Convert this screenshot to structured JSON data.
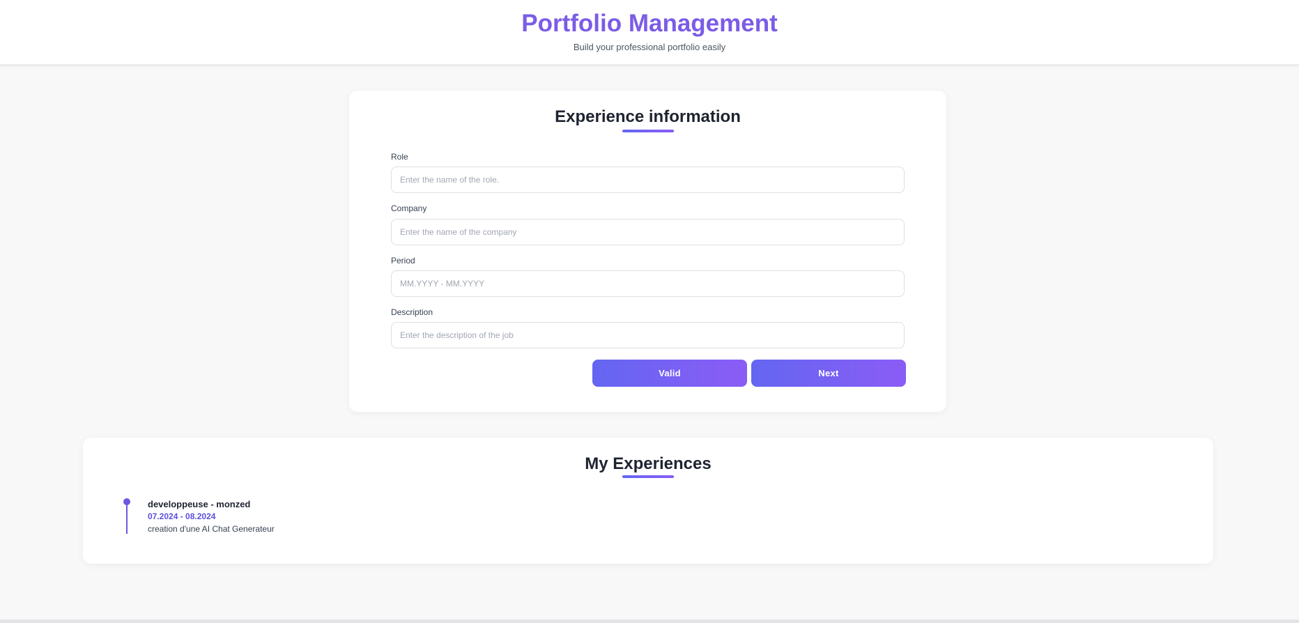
{
  "header": {
    "title": "Portfolio Management",
    "subtitle": "Build your professional portfolio easily"
  },
  "form": {
    "title": "Experience information",
    "fields": {
      "role": {
        "label": "Role",
        "placeholder": "Enter the name of the role.",
        "value": ""
      },
      "company": {
        "label": "Company",
        "placeholder": "Enter the name of the company",
        "value": ""
      },
      "period": {
        "label": "Period",
        "placeholder": "MM.YYYY - MM.YYYY",
        "value": ""
      },
      "description": {
        "label": "Description",
        "placeholder": "Enter the description of the job",
        "value": ""
      }
    },
    "buttons": {
      "valid": "Valid",
      "next": "Next"
    }
  },
  "experiences": {
    "title": "My Experiences",
    "items": [
      {
        "role": "developpeuse",
        "separator": " - ",
        "company": "monzed",
        "period": "07.2024 - 08.2024",
        "description": "creation d'une AI Chat Generateur"
      }
    ]
  },
  "colors": {
    "accent": "#7b5ce6",
    "gradient_start": "#6366f1",
    "gradient_end": "#8b5cf6",
    "background": "#f8f8f9",
    "card": "#ffffff"
  }
}
